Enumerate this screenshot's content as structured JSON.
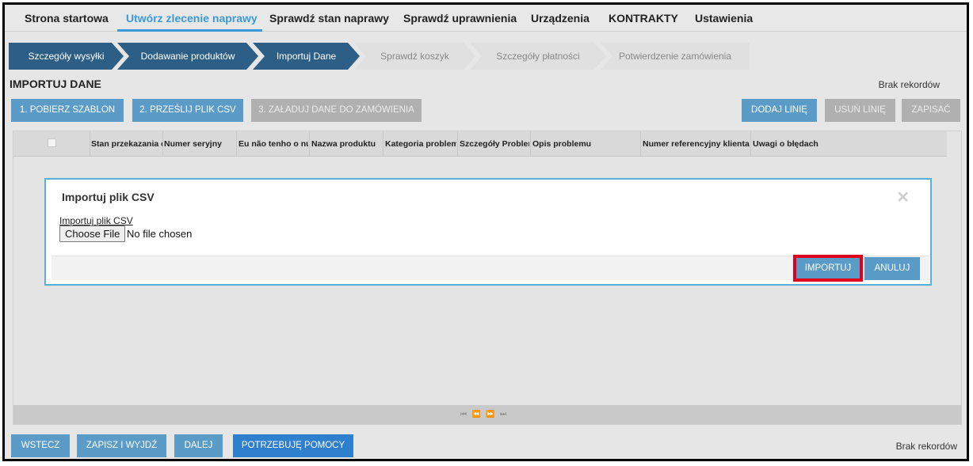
{
  "top_nav": {
    "items": [
      {
        "label": "Strona startowa"
      },
      {
        "label": "Utwórz zlecenie naprawy"
      },
      {
        "label": "Sprawdź stan naprawy"
      },
      {
        "label": "Sprawdź uprawnienia"
      },
      {
        "label": "Urządzenia"
      },
      {
        "label": "KONTRAKTY"
      },
      {
        "label": "Ustawienia"
      }
    ],
    "active_index": 1
  },
  "wizard": {
    "steps": [
      {
        "label": "Szczegóły wysyłki",
        "state": "done"
      },
      {
        "label": "Dodawanie produktów",
        "state": "done"
      },
      {
        "label": "Importuj Dane",
        "state": "done"
      },
      {
        "label": "Sprawdź koszyk",
        "state": "todo"
      },
      {
        "label": "Szczegóły płatności",
        "state": "todo"
      },
      {
        "label": "Potwierdzenie zamówienia",
        "state": "todo"
      }
    ]
  },
  "page": {
    "title": "IMPORTUJ DANE",
    "no_records": "Brak rekordów"
  },
  "actions": {
    "download_template": "1. POBIERZ SZABLON",
    "upload_csv": "2. PRZEŚLIJ PLIK CSV",
    "load_data": "3. ZAŁADUJ DANE DO ZAMÓWIENIA",
    "add_line": "DODAJ LINIĘ",
    "remove_line": "USUŃ LINIĘ",
    "save": "ZAPISAĆ"
  },
  "grid": {
    "columns": [
      "Stan przekazania d",
      "Numer seryjny",
      "Eu não tenho o nú",
      "Nazwa produktu",
      "Kategoria problem",
      "Szczegóły Problem",
      "Opis problemu",
      "Numer referencyjny klienta",
      "Uwagi o błędach"
    ],
    "pager": "⏮ ⏪ ⏩ ⏭"
  },
  "modal": {
    "title": "Importuj plik CSV",
    "close": "✕",
    "field_label": "Importuj plik CSV",
    "choose_file": "Choose File",
    "no_file": "No file chosen",
    "import_button": "IMPORTUJ",
    "cancel_button": "ANULUJ"
  },
  "footer": {
    "back": "WSTECZ",
    "save_exit": "ZAPISZ I WYJDŹ",
    "next": "DALEJ",
    "help": "POTRZEBUJĘ POMOCY",
    "no_records": "Brak rekordów"
  },
  "colors": {
    "accent": "#3a9ad9",
    "step_done": "#2d5f86",
    "step_todo": "#e0e0e0",
    "button": "#5a9bc7",
    "button_primary": "#2f7fcf",
    "highlight": "#e0001b"
  }
}
